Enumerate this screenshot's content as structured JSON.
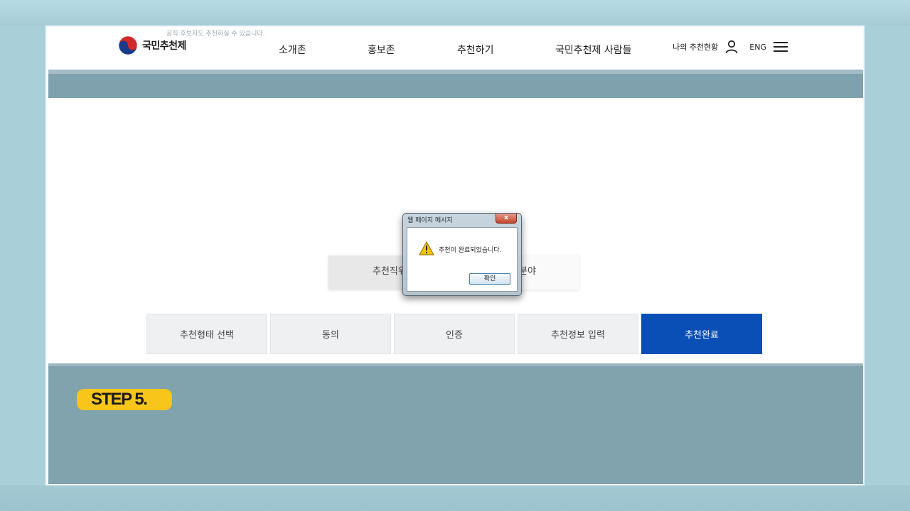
{
  "header": {
    "logo_text": "국민추천제",
    "tip_text": "공직 후보자도 추천하실 수 있습니다.",
    "nav": [
      "소개존",
      "홍보존",
      "추천하기",
      "국민추천제 사람들"
    ],
    "my_status_label": "나의 추천현황",
    "lang_label": "ENG"
  },
  "field": {
    "left_label": "추천직위",
    "right_label": "분야"
  },
  "steps": [
    {
      "label": "추천형태 선택",
      "active": false
    },
    {
      "label": "동의",
      "active": false
    },
    {
      "label": "인증",
      "active": false
    },
    {
      "label": "추천정보 입력",
      "active": false
    },
    {
      "label": "추천완료",
      "active": true
    }
  ],
  "dialog": {
    "title": "웹 페이지 메시지",
    "close": "x",
    "message": "추천이 완료되었습니다.",
    "ok_label": "확인"
  },
  "step_badge": "STEP 5.",
  "colors": {
    "accent_blue": "#0a4fb5",
    "badge_yellow": "#f8c51a",
    "band_grey": "#80a3ae"
  }
}
